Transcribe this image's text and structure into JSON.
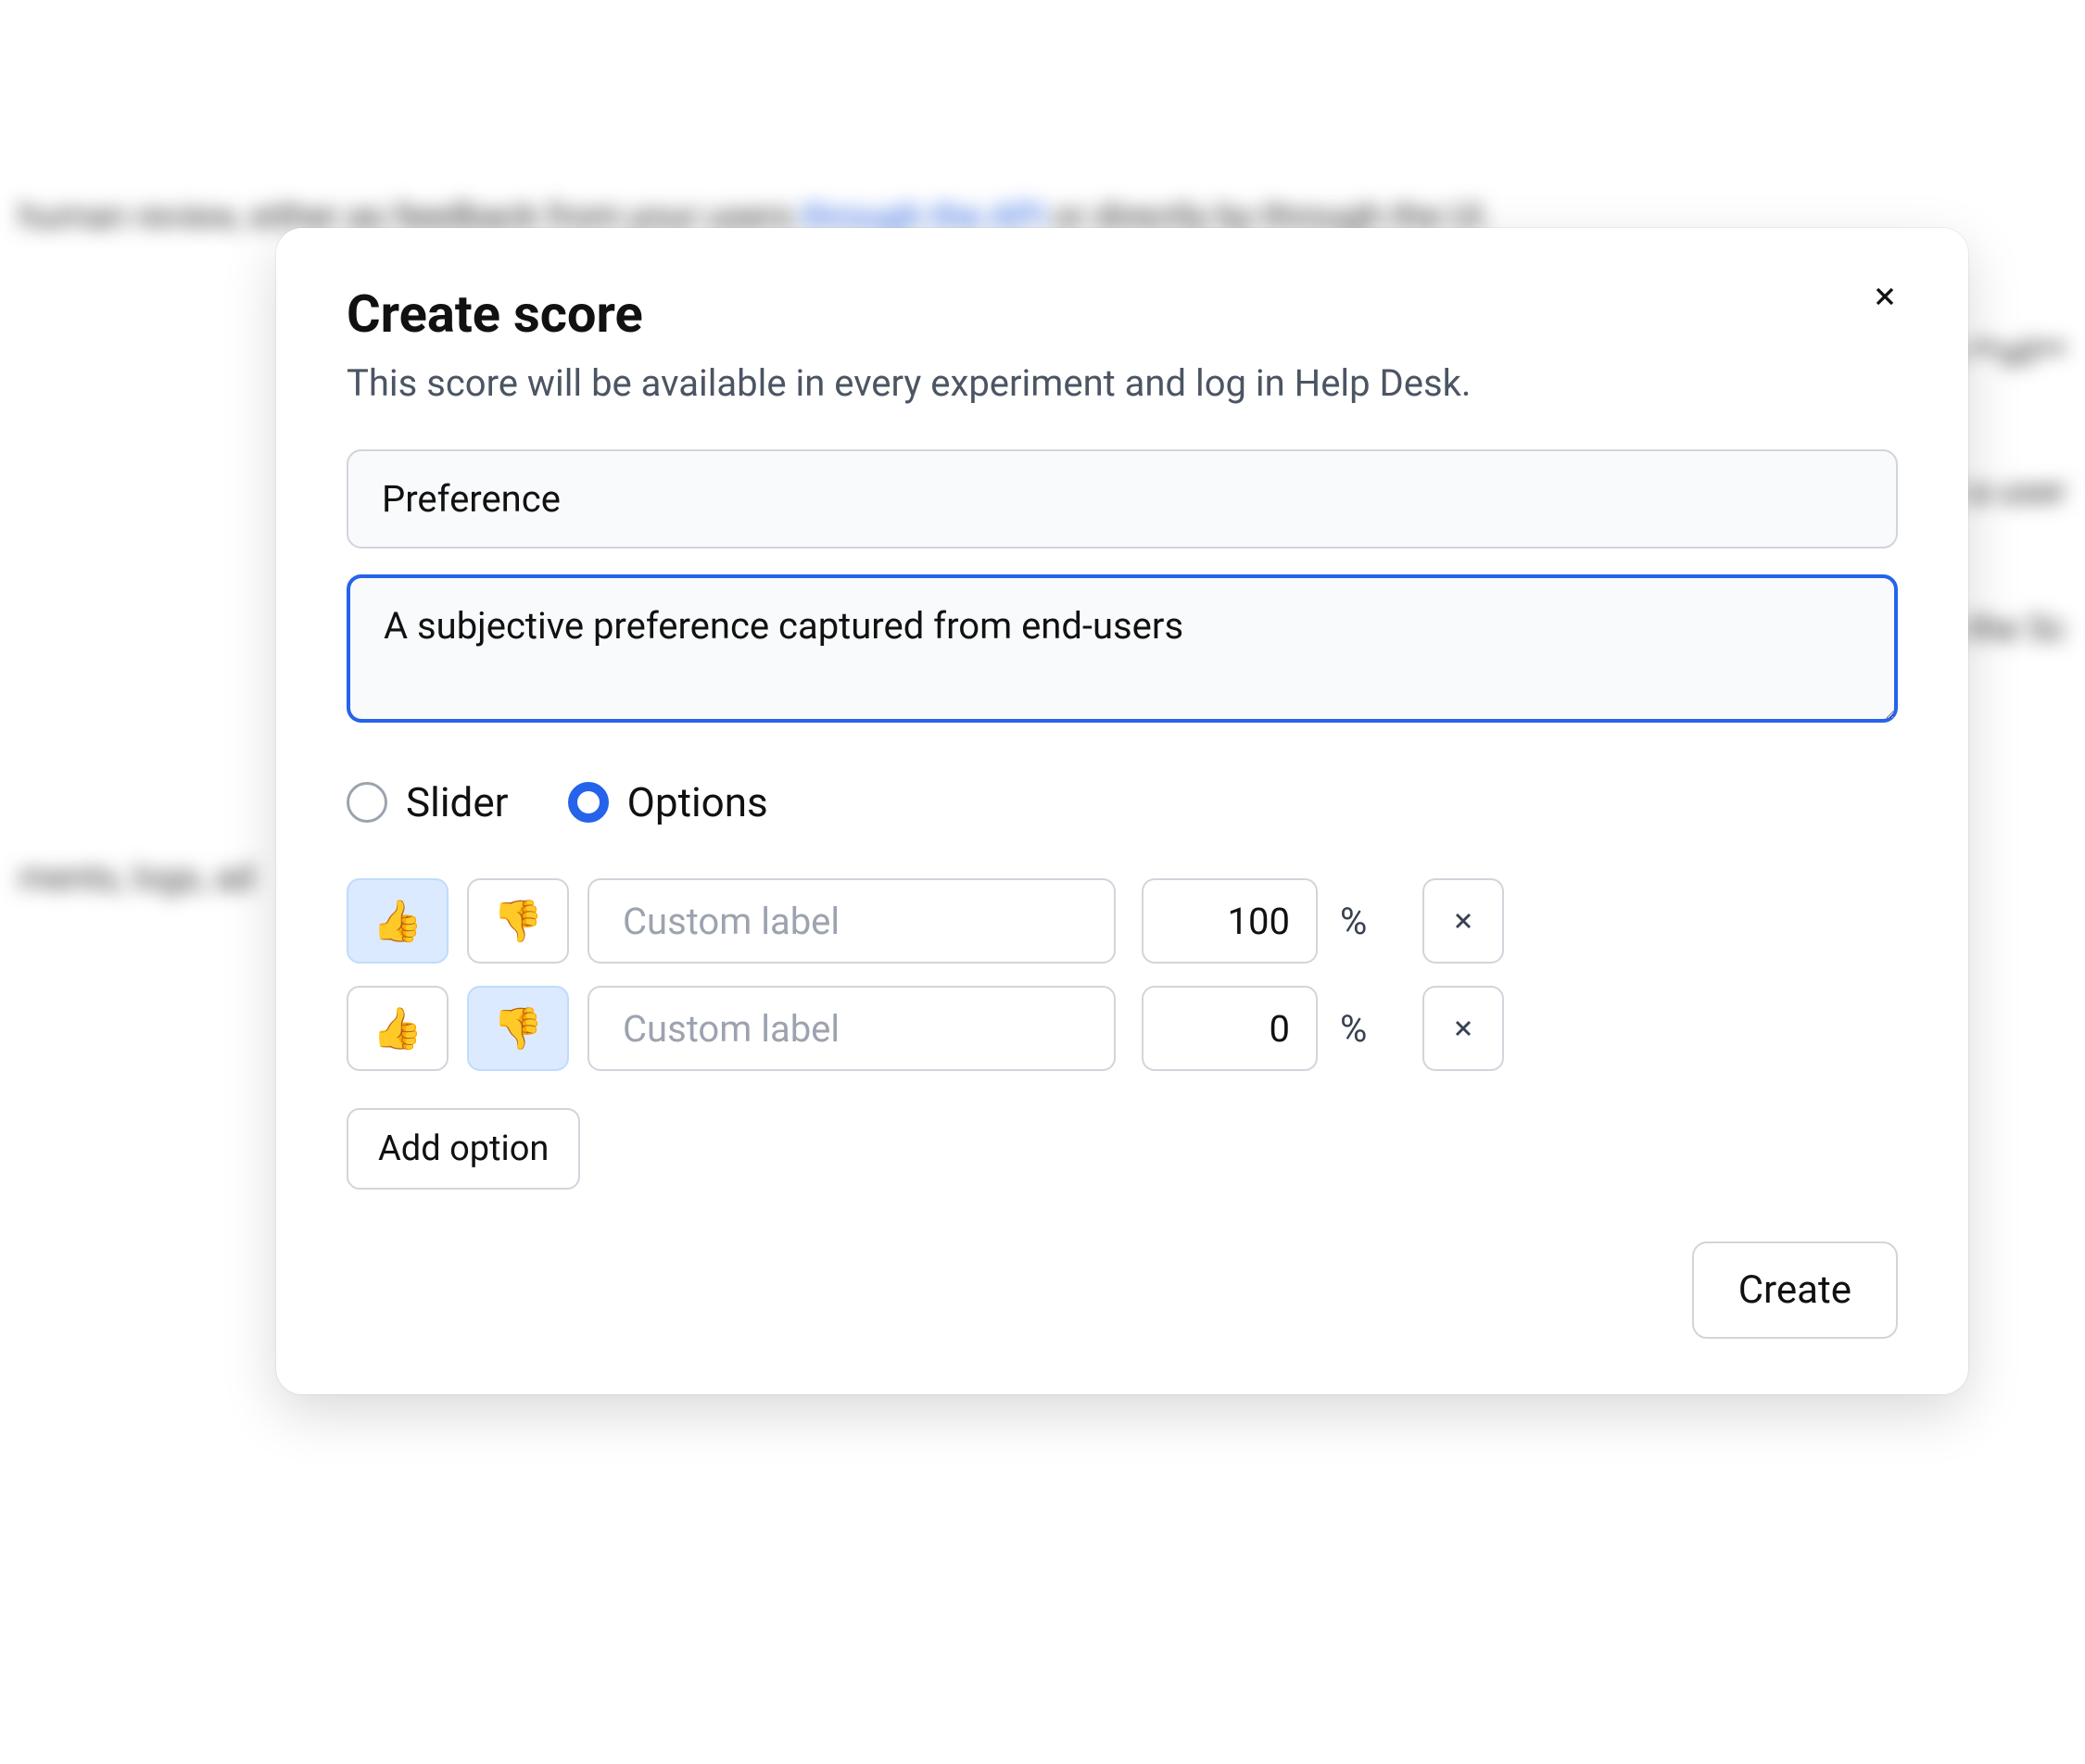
{
  "modal": {
    "title": "Create score",
    "subtitle": "This score will be available in every experiment and log in Help Desk.",
    "name_value": "Preference",
    "description_value": "A subjective preference captured from end-users",
    "type_radios": {
      "slider_label": "Slider",
      "options_label": "Options",
      "selected": "options"
    },
    "options": [
      {
        "thumbs_up_selected": true,
        "thumbs_down_selected": false,
        "custom_label_placeholder": "Custom label",
        "custom_label_value": "",
        "value": "100",
        "percent": "%"
      },
      {
        "thumbs_up_selected": false,
        "thumbs_down_selected": true,
        "custom_label_placeholder": "Custom label",
        "custom_label_value": "",
        "value": "0",
        "percent": "%"
      }
    ],
    "add_option_label": "Add option",
    "create_button_label": "Create"
  },
  "icons": {
    "thumbs_up": "👍",
    "thumbs_down": "👎"
  },
  "background": {
    "line1_a": "human review, either as feedback from your users ",
    "line1_link": "through the API",
    "line1_b": " or directly by through the UI.",
    "line2": "to **all** ",
    "line3": "e that a user",
    "line4": "ats to the Sc",
    "line5": "ments, logs, ad"
  }
}
